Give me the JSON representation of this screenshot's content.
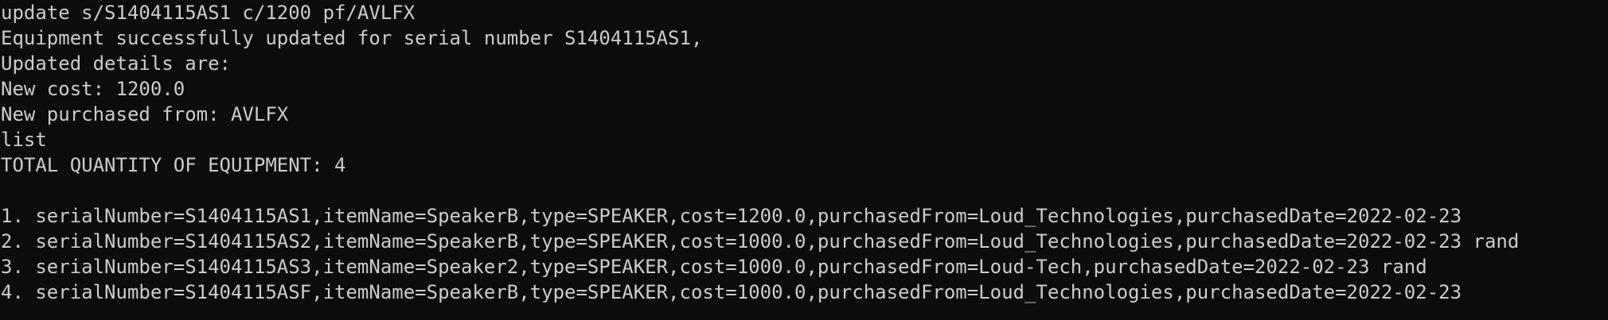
{
  "terminal": {
    "lines": [
      "update s/S1404115AS1 c/1200 pf/AVLFX",
      "Equipment successfully updated for serial number S1404115AS1,",
      "Updated details are:",
      "New cost: 1200.0",
      "New purchased from: AVLFX",
      "list",
      "TOTAL QUANTITY OF EQUIPMENT: 4",
      "",
      "1. serialNumber=S1404115AS1,itemName=SpeakerB,type=SPEAKER,cost=1200.0,purchasedFrom=Loud_Technologies,purchasedDate=2022-02-23",
      "2. serialNumber=S1404115AS2,itemName=SpeakerB,type=SPEAKER,cost=1000.0,purchasedFrom=Loud_Technologies,purchasedDate=2022-02-23 rand",
      "3. serialNumber=S1404115AS3,itemName=Speaker2,type=SPEAKER,cost=1000.0,purchasedFrom=Loud-Tech,purchasedDate=2022-02-23 rand",
      "4. serialNumber=S1404115ASF,itemName=SpeakerB,type=SPEAKER,cost=1000.0,purchasedFrom=Loud_Technologies,purchasedDate=2022-02-23"
    ]
  },
  "colors": {
    "background": "#0c0c0c",
    "text": "#cccccc"
  }
}
